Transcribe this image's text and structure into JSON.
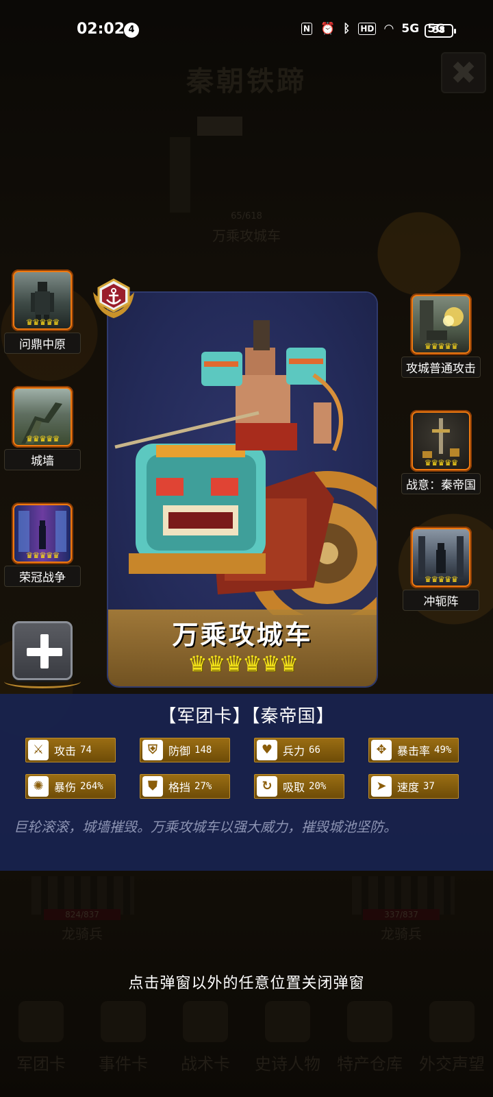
{
  "status_bar": {
    "time": "02:02",
    "notification_count": "4",
    "nfc": "N",
    "hd": "HD",
    "net1": "5G",
    "net2": "5G",
    "battery": "58"
  },
  "background": {
    "title": "秦朝铁蹄",
    "enemy_hp": "65/618",
    "enemy_name": "万乘攻城车",
    "left_unit": {
      "hp": "824/837",
      "name": "龙骑兵"
    },
    "right_unit": {
      "hp": "337/837",
      "name": "龙骑兵"
    },
    "nav": [
      "军团卡",
      "事件卡",
      "战术卡",
      "史诗人物",
      "特产仓库",
      "外交声望"
    ]
  },
  "left_slots": [
    {
      "label": "问鼎中原",
      "icon": "warrior-icon",
      "crowns": "♛♛♛♛♛"
    },
    {
      "label": "城墙",
      "icon": "wall-icon",
      "crowns": "♛♛♛♛♛"
    },
    {
      "label": "荣冠战争",
      "icon": "glory-war-icon",
      "crowns": "♛♛♛♛♛"
    }
  ],
  "right_slots": [
    {
      "label": "攻城普通攻击",
      "icon": "siege-attack-icon",
      "crowns": "♛♛♛♛♛"
    },
    {
      "label": "战意：秦帝国",
      "icon": "sword-icon",
      "crowns": "♛♛♛♛♛"
    },
    {
      "label": "冲轭阵",
      "icon": "charge-formation-icon",
      "crowns": "♛♛♛♛♛"
    }
  ],
  "card": {
    "name": "万乘攻城车",
    "stars": "♛♛♛♛♛♛",
    "badge_icon": "anchor-icon"
  },
  "panel": {
    "tags": "【军团卡】【秦帝国】",
    "stats": [
      {
        "icon": "attack-icon",
        "glyph": "⚔",
        "label": "攻击",
        "value": "74"
      },
      {
        "icon": "defense-icon",
        "glyph": "⛨",
        "label": "防御",
        "value": "148"
      },
      {
        "icon": "troops-icon",
        "glyph": "♥",
        "label": "兵力",
        "value": "66"
      },
      {
        "icon": "crit-rate-icon",
        "glyph": "✥",
        "label": "暴击率",
        "value": "49%"
      },
      {
        "icon": "crit-damage-icon",
        "glyph": "✺",
        "label": "暴伤",
        "value": "264%"
      },
      {
        "icon": "block-icon",
        "glyph": "⛊",
        "label": "格挡",
        "value": "27%"
      },
      {
        "icon": "lifesteal-icon",
        "glyph": "↻",
        "label": "吸取",
        "value": "20%"
      },
      {
        "icon": "speed-icon",
        "glyph": "➤",
        "label": "速度",
        "value": "37"
      }
    ],
    "description": "巨轮滚滚，城墙摧毁。万乘攻城车以强大威力，摧毁城池坚防。"
  },
  "hint": "点击弹窗以外的任意位置关闭弹窗"
}
